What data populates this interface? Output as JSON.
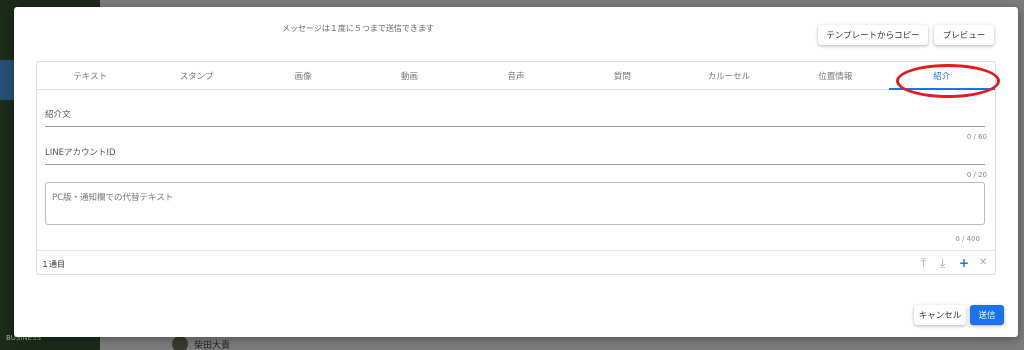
{
  "background": {
    "footer_user_name": "柴田大貴",
    "left_bottom_label": "BUSINESS"
  },
  "modal": {
    "notice": "メッセージは１度に５つまで送信できます",
    "copy_template_label": "テンプレートからコピー",
    "preview_label": "プレビュー",
    "tabs": [
      {
        "label": "テキスト"
      },
      {
        "label": "スタンプ"
      },
      {
        "label": "画像"
      },
      {
        "label": "動画"
      },
      {
        "label": "音声"
      },
      {
        "label": "質問"
      },
      {
        "label": "カルーセル"
      },
      {
        "label": "位置情報"
      },
      {
        "label": "紹介",
        "active": true
      }
    ],
    "intro_field": {
      "label": "紹介文",
      "counter": "0 / 60"
    },
    "line_id_field": {
      "label": "LINEアカウントID",
      "counter": "0 / 20"
    },
    "alt_text_field": {
      "placeholder": "PC版・通知欄での代替テキスト",
      "counter": "0 / 400"
    },
    "item_count": "１通目",
    "controls": {
      "move_up": "⤒",
      "move_down": "⤓",
      "add": "+",
      "remove": "✕"
    },
    "cancel_label": "キャンセル",
    "send_label": "送信"
  },
  "colors": {
    "accent": "#1a73e8",
    "highlight": "#e21b1b"
  }
}
